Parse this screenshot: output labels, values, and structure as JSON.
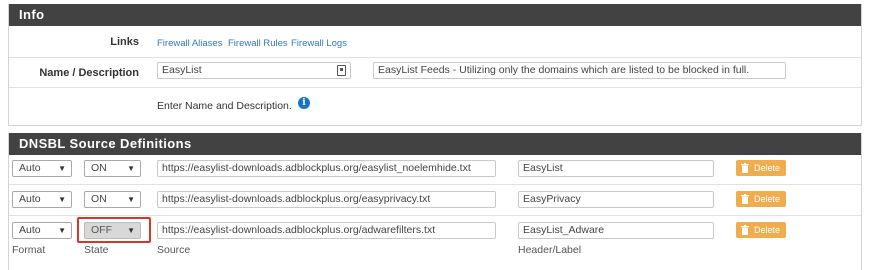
{
  "info": {
    "header": "Info",
    "links_label": "Links",
    "links": [
      "Firewall Aliases",
      "Firewall Rules",
      "Firewall Logs"
    ],
    "name_desc_label": "Name / Description",
    "name_value": "EasyList",
    "description_value": "EasyList Feeds - Utilizing only the domains which are listed to be blocked in full.",
    "help_text": "Enter Name and Description.",
    "info_icon": "info-circle-icon"
  },
  "dnsbl": {
    "header": "DNSBL Source Definitions",
    "rows": [
      {
        "format": "Auto",
        "state": "ON",
        "source": "https://easylist-downloads.adblockplus.org/easylist_noelemhide.txt",
        "header_label": "EasyList",
        "delete_label": "Delete"
      },
      {
        "format": "Auto",
        "state": "ON",
        "source": "https://easylist-downloads.adblockplus.org/easyprivacy.txt",
        "header_label": "EasyPrivacy",
        "delete_label": "Delete"
      },
      {
        "format": "Auto",
        "state": "OFF",
        "source": "https://easylist-downloads.adblockplus.org/adwarefilters.txt",
        "header_label": "EasyList_Adware",
        "delete_label": "Delete"
      }
    ],
    "column_labels": {
      "format": "Format",
      "state": "State",
      "source": "Source",
      "header_label": "Header/Label"
    }
  },
  "colors": {
    "panel_header_bg": "#424242",
    "link": "#337ab7",
    "delete_button": "#f0ad4e",
    "highlight_border": "#d9342b",
    "info_icon": "#1a73c7"
  }
}
